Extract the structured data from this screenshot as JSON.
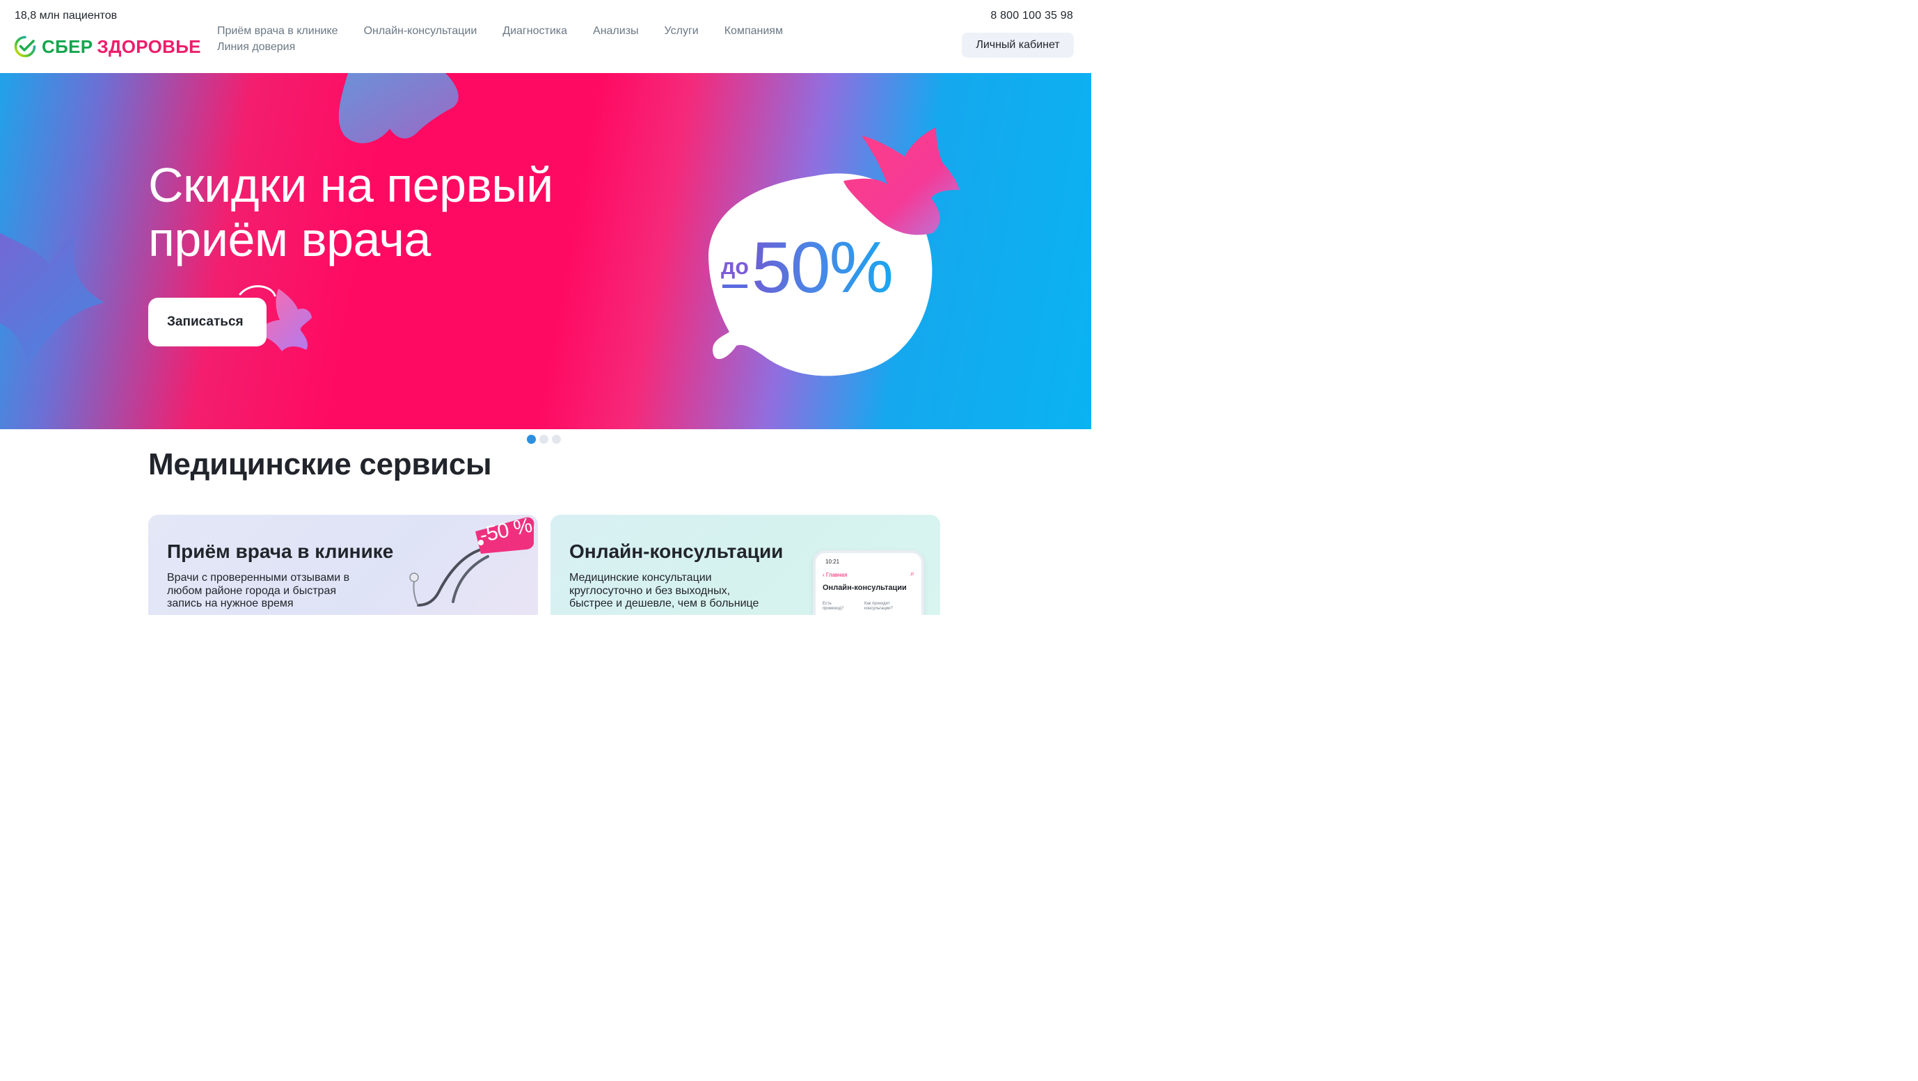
{
  "header": {
    "patients": "18,8 млн пациентов",
    "phone": "8 800 100 35 98",
    "logo": {
      "part1": "СБЕР",
      "part2": "ЗДОРОВЬЕ"
    },
    "nav_row1": [
      "Приём врача в клинике",
      "Онлайн-консультации",
      "Диагностика",
      "Анализы",
      "Услуги",
      "Компаниям"
    ],
    "nav_row2": [
      "Линия доверия"
    ],
    "cabinet_label": "Личный кабинет"
  },
  "hero": {
    "title_line1": "Скидки на первый",
    "title_line2": "приём врача",
    "button_label": "Записаться",
    "discount_prefix": "до",
    "discount_value": "50%"
  },
  "carousel": {
    "slides": 3,
    "active": 1
  },
  "services": {
    "title": "Медицинские сервисы",
    "cards": [
      {
        "title": "Приём врача в клинике",
        "description": "Врачи с проверенными отзывами в\nлюбом районе города и быстрая\nзапись на нужное время",
        "badge": "-50 %"
      },
      {
        "title": "Онлайн-консультации",
        "description": "Медицинские консультации\nкруглосуточно и без выходных,\nбыстрее и дешевле, чем в больнице",
        "phone_mock": {
          "time": "10:21",
          "back": "Главная",
          "title": "Онлайн-консультации",
          "q1": "Есть\nпромокод?",
          "q2": "Как проходят\nконсультации?"
        }
      }
    ]
  },
  "colors": {
    "brand_green": "#12a64c",
    "brand_pink": "#ee1d6b",
    "hero_pink": "#ff0a62",
    "hero_blue": "#0ab3f2",
    "dot_active": "#2c8fdf"
  }
}
